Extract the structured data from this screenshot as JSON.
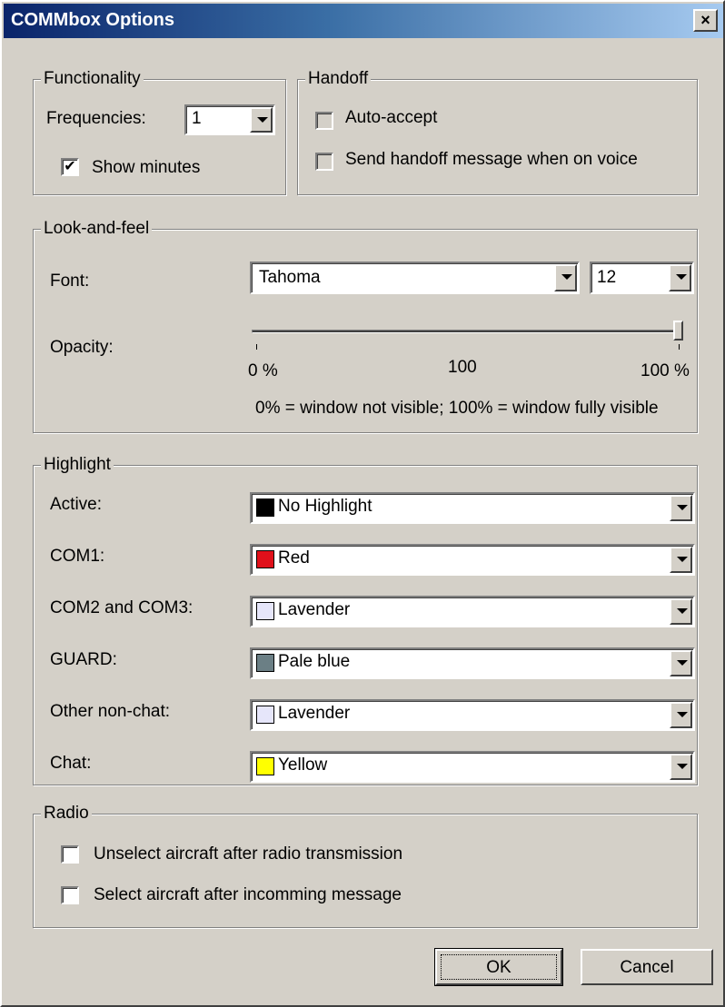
{
  "window": {
    "title": "COMMbox Options",
    "close_glyph": "×"
  },
  "functionality": {
    "legend": "Functionality",
    "frequencies_label": "Frequencies:",
    "frequencies_value": "1",
    "show_minutes_label": "Show minutes",
    "show_minutes_checked": true
  },
  "handoff": {
    "legend": "Handoff",
    "auto_accept_label": "Auto-accept",
    "auto_accept_checked": false,
    "send_message_label": "Send handoff message when on voice",
    "send_message_checked": false
  },
  "look": {
    "legend": "Look-and-feel",
    "font_label": "Font:",
    "font_value": "Tahoma",
    "size_value": "12",
    "opacity_label": "Opacity:",
    "opacity_percent": 100,
    "tick_min": "0 %",
    "tick_mid": "100",
    "tick_max": "100 %",
    "note": "0% = window not visible; 100% = window fully visible"
  },
  "highlight": {
    "legend": "Highlight",
    "rows": [
      {
        "label": "Active:",
        "value": "No Highlight",
        "color": "#000000"
      },
      {
        "label": "COM1:",
        "value": "Red",
        "color": "#e0101a"
      },
      {
        "label": "COM2 and COM3:",
        "value": "Lavender",
        "color": "#e6e6fa"
      },
      {
        "label": "GUARD:",
        "value": "Pale blue",
        "color": "#6b7f85"
      },
      {
        "label": "Other non-chat:",
        "value": "Lavender",
        "color": "#e6e6fa"
      },
      {
        "label": "Chat:",
        "value": "Yellow",
        "color": "#ffff00"
      }
    ]
  },
  "radio": {
    "legend": "Radio",
    "unselect_label": "Unselect aircraft after radio transmission",
    "unselect_checked": false,
    "select_label": "Select aircraft after incomming message",
    "select_checked": false
  },
  "buttons": {
    "ok": "OK",
    "cancel": "Cancel"
  }
}
